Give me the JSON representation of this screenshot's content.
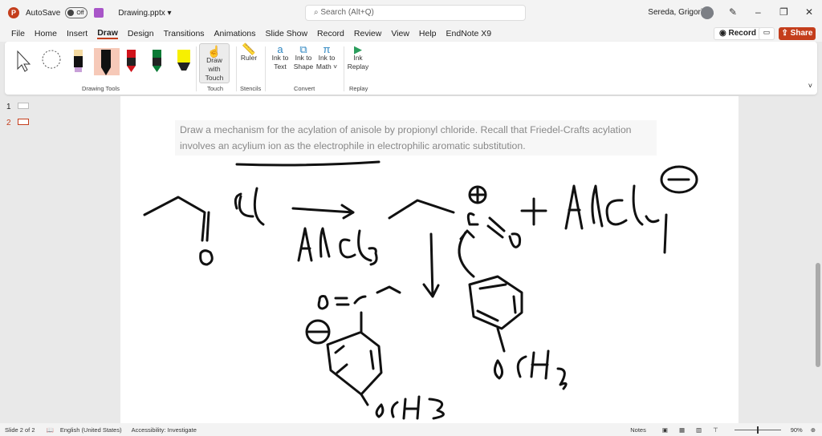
{
  "titlebar": {
    "app_icon": "P",
    "autosave": "AutoSave",
    "autosave_state": "Off",
    "filename": "Drawing.pptx ▾",
    "search_placeholder": "Search (Alt+Q)",
    "user": "Sereda, Grigoriy A",
    "minimize": "–",
    "restore": "❐",
    "close": "✕",
    "pen": "✎"
  },
  "menu": {
    "items": [
      "File",
      "Home",
      "Insert",
      "Draw",
      "Design",
      "Transitions",
      "Animations",
      "Slide Show",
      "Record",
      "Review",
      "View",
      "Help",
      "EndNote X9"
    ],
    "active": "Draw",
    "record": "◉ Record",
    "comment": "▭",
    "share": "⇪ Share"
  },
  "ribbon": {
    "groups": {
      "drawing_tools": "Drawing Tools",
      "touch": "Touch",
      "stencils": "Stencils",
      "convert": "Convert",
      "replay": "Replay"
    },
    "draw_with_touch": "Draw with Touch",
    "ruler": "Ruler",
    "ink_to_text": "Ink to Text",
    "ink_to_shape": "Ink to Shape",
    "ink_to_math": "Ink to Math ˅",
    "ink_replay": "Ink Replay",
    "pens": [
      {
        "color": "#f3d9a0"
      },
      {
        "color": "#000000"
      },
      {
        "color": "#d0141c"
      },
      {
        "color": "#0a7a35"
      },
      {
        "color": "#f7f000"
      }
    ]
  },
  "thumbnails": [
    {
      "num": "1"
    },
    {
      "num": "2"
    }
  ],
  "slide": {
    "prompt": "Draw a mechanism for the acylation of anisole by propionyl chloride. Recall that Friedel-Crafts acylation involves an acylium ion as the electrophile in electrophilic aromatic substitution."
  },
  "status": {
    "slide": "Slide 2 of 2",
    "language": "English (United States)",
    "accessibility": "Accessibility: Investigate",
    "notes": "Notes",
    "zoom": "90%"
  }
}
